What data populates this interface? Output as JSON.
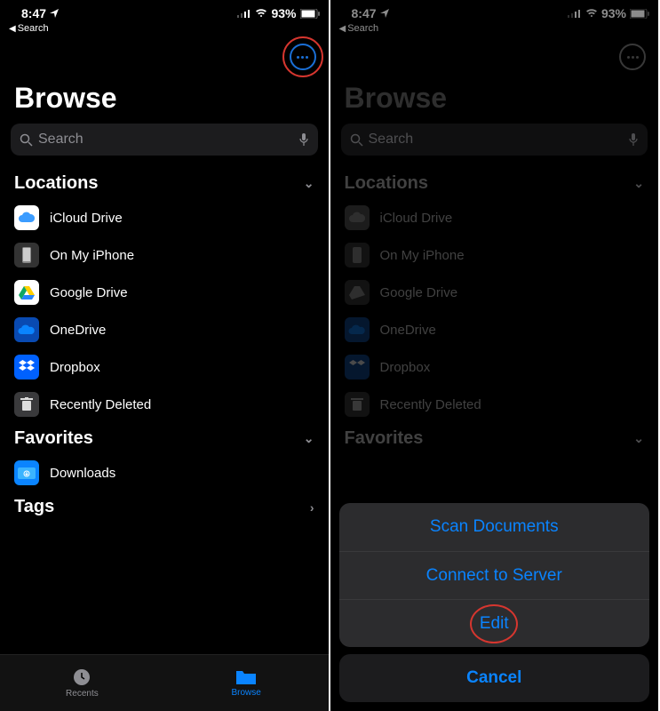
{
  "status": {
    "time": "8:47",
    "battery": "93%",
    "back_label": "Search"
  },
  "left": {
    "title": "Browse",
    "search_placeholder": "Search",
    "sections": {
      "locations": {
        "header": "Locations",
        "items": [
          "iCloud Drive",
          "On My iPhone",
          "Google Drive",
          "OneDrive",
          "Dropbox",
          "Recently Deleted"
        ]
      },
      "favorites": {
        "header": "Favorites",
        "items": [
          "Downloads"
        ]
      },
      "tags": {
        "header": "Tags"
      }
    },
    "tabs": {
      "recents": "Recents",
      "browse": "Browse"
    },
    "highlight": "more-button"
  },
  "right": {
    "title": "Browse",
    "search_placeholder": "Search",
    "sections": {
      "locations": {
        "header": "Locations",
        "items": [
          "iCloud Drive",
          "On My iPhone",
          "Google Drive",
          "OneDrive",
          "Dropbox",
          "Recently Deleted"
        ]
      },
      "favorites": {
        "header": "Favorites"
      }
    },
    "action_sheet": {
      "options": [
        "Scan Documents",
        "Connect to Server",
        "Edit"
      ],
      "cancel": "Cancel",
      "highlight": "Edit"
    }
  }
}
